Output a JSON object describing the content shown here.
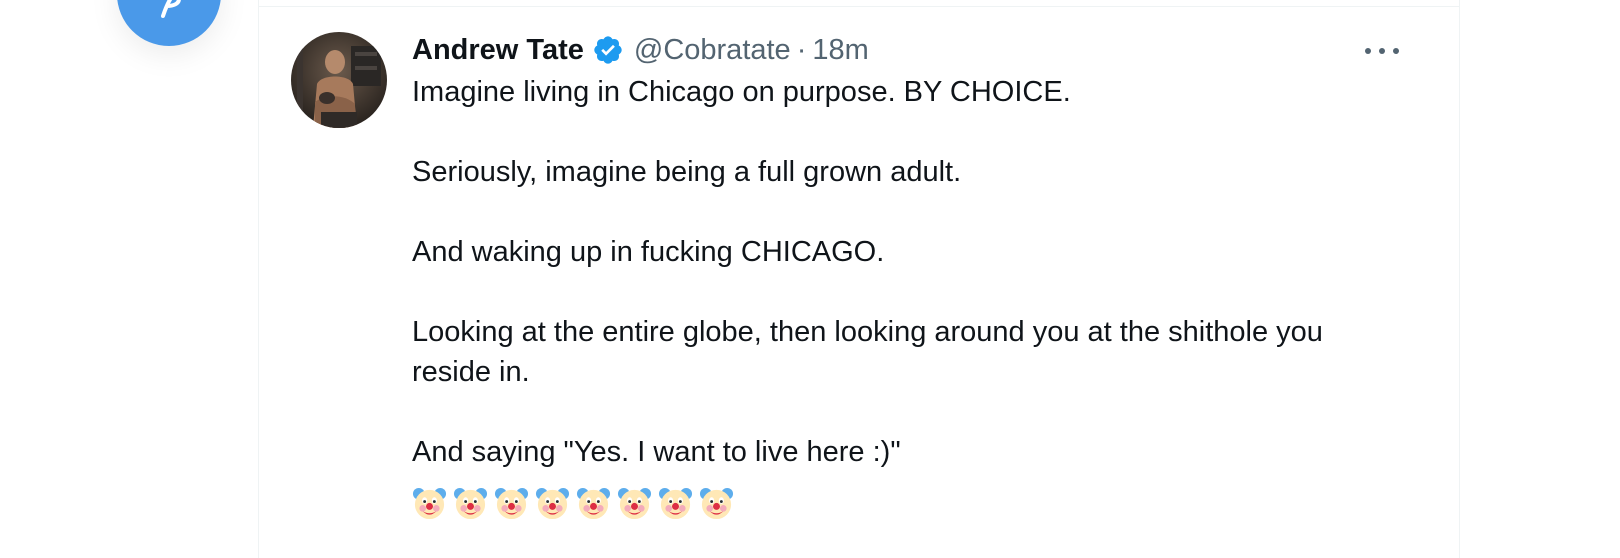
{
  "tweet": {
    "display_name": "Andrew Tate",
    "handle": "@Cobratate",
    "separator": "·",
    "time": "18m",
    "paragraphs": [
      "Imagine living in Chicago on purpose. BY CHOICE.",
      "Seriously, imagine being a full grown adult.",
      "And waking up in fucking CHICAGO.",
      "Looking at the entire globe, then looking around you at the shithole you reside in.",
      "And saying \"Yes. I want to live here :)\""
    ],
    "emoji": "clown-face",
    "emoji_count": 8
  },
  "icons": {
    "verified": "verified-badge-icon",
    "more": "more-options-icon",
    "compose": "compose-post-icon"
  },
  "colors": {
    "accent": "#4a99e9",
    "verified": "#1d9bf0",
    "text": "#0f1419",
    "secondary": "#536471",
    "divider": "#eff3f4"
  }
}
